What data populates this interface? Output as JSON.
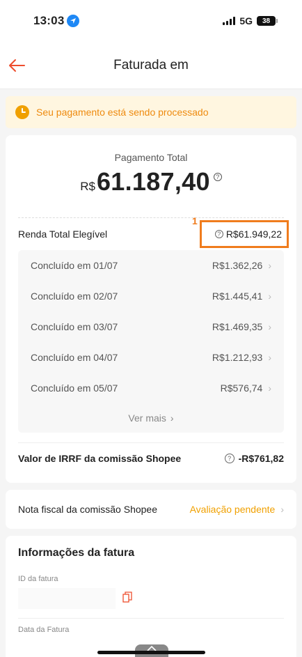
{
  "status_bar": {
    "time": "13:03",
    "network": "5G",
    "battery": "38"
  },
  "header": {
    "title": "Faturada em"
  },
  "banner": {
    "text": "Seu pagamento está sendo processado"
  },
  "total": {
    "label": "Pagamento Total",
    "currency": "R$",
    "amount": "61.187,40"
  },
  "income": {
    "marker": "1",
    "label": "Renda Total Elegível",
    "value": "R$61.949,22"
  },
  "breakdown": [
    {
      "label": "Concluído em 01/07",
      "value": "R$1.362,26"
    },
    {
      "label": "Concluído em 02/07",
      "value": "R$1.445,41"
    },
    {
      "label": "Concluído em 03/07",
      "value": "R$1.469,35"
    },
    {
      "label": "Concluído em 04/07",
      "value": "R$1.212,93"
    },
    {
      "label": "Concluído em 05/07",
      "value": "R$576,74"
    }
  ],
  "see_more": "Ver mais",
  "irrf": {
    "label": "Valor de IRRF da comissão Shopee",
    "value": "-R$761,82"
  },
  "nota": {
    "label": "Nota fiscal da comissão Shopee",
    "status": "Avaliação pendente"
  },
  "info": {
    "title": "Informações da fatura",
    "id_label": "ID da fatura",
    "date_label": "Data da Fatura"
  },
  "colors": {
    "accent": "#ee4d2d",
    "highlight": "#f07c1d",
    "banner_bg": "#fff6e0",
    "banner_text": "#ee8a0e",
    "pending": "#f0a000"
  },
  "icons": {
    "back": "arrow-left-icon",
    "clock": "clock-icon",
    "help": "question-circle-icon",
    "chevron": "chevron-right-icon",
    "copy": "copy-icon"
  }
}
